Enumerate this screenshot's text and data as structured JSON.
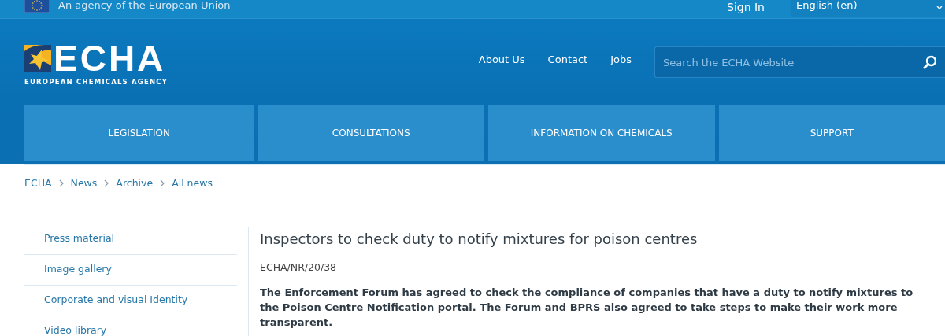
{
  "top_bar": {
    "agency_text": "An agency of the European Union",
    "sign_in": "Sign In",
    "language": "English (en)"
  },
  "header": {
    "logo_name": "ECHA",
    "logo_subtitle": "EUROPEAN CHEMICALS AGENCY",
    "links": [
      "About Us",
      "Contact",
      "Jobs"
    ],
    "search": {
      "placeholder": "Search the ECHA Website"
    }
  },
  "nav_tabs": [
    "LEGISLATION",
    "CONSULTATIONS",
    "INFORMATION ON CHEMICALS",
    "SUPPORT"
  ],
  "breadcrumb": [
    "ECHA",
    "News",
    "Archive",
    "All news"
  ],
  "sidebar": {
    "items": [
      "Press material",
      "Image gallery",
      "Corporate and visual Identity",
      "Video library"
    ]
  },
  "article": {
    "title": "Inspectors to check duty to notify mixtures for poison centres",
    "reference": "ECHA/NR/20/38",
    "lead": "The Enforcement Forum has agreed to check the compliance of companies that have a duty to notify mixtures to the Poison Centre Notification portal. The Forum and BPRS also agreed to take steps to make their work more transparent."
  }
}
